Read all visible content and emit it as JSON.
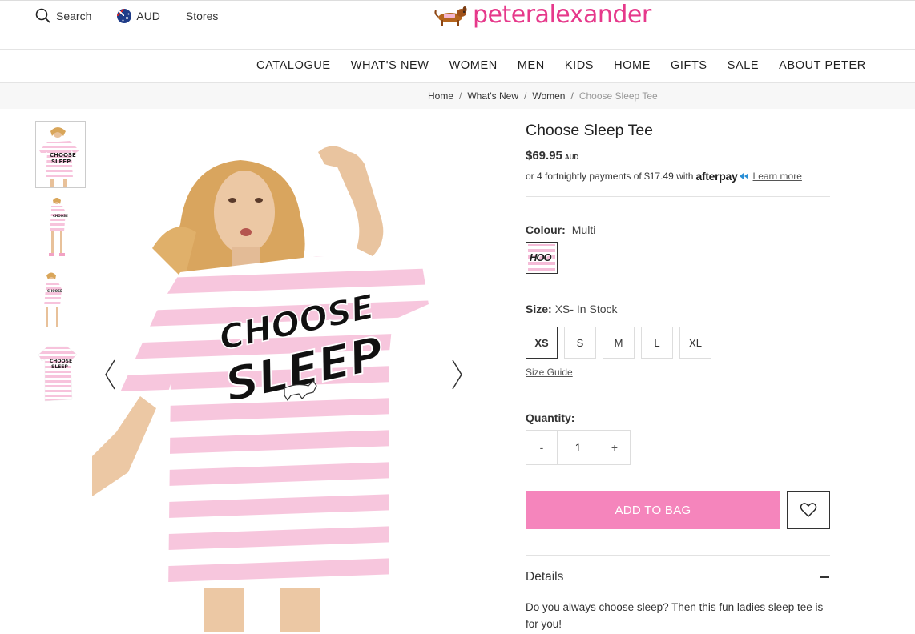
{
  "header": {
    "search_label": "Search",
    "currency_label": "AUD",
    "stores_label": "Stores",
    "logo_text": "peteralexander",
    "brand_color": "#e6398b"
  },
  "nav": {
    "items": [
      "CATALOGUE",
      "WHAT'S NEW",
      "WOMEN",
      "MEN",
      "KIDS",
      "HOME",
      "GIFTS",
      "SALE",
      "ABOUT PETER"
    ]
  },
  "breadcrumb": {
    "items": [
      "Home",
      "What's New",
      "Women"
    ],
    "current": "Choose Sleep Tee"
  },
  "product": {
    "title": "Choose Sleep Tee",
    "price": "$69.95",
    "currency": "AUD",
    "afterpay_text": "or 4 fortnightly payments of $17.49 with",
    "afterpay_brand": "afterpay",
    "afterpay_link": "Learn more",
    "colour_label": "Colour:",
    "colour_value": "Multi",
    "size_label": "Size:",
    "size_value": "XS- In Stock",
    "sizes": [
      "XS",
      "S",
      "M",
      "L",
      "XL"
    ],
    "selected_size": "XS",
    "size_guide": "Size Guide",
    "quantity_label": "Quantity:",
    "quantity_minus": "-",
    "quantity_value": "1",
    "quantity_plus": "+",
    "add_to_bag": "ADD TO BAG",
    "details_label": "Details",
    "details_text": "Do you always choose sleep? Then this fun ladies sleep tee is for you!",
    "accent_color": "#f585bc"
  },
  "icons": {
    "search": "search-icon",
    "flag": "australia-flag-icon",
    "wishlist": "heart-icon",
    "prev": "chevron-left-icon",
    "next": "chevron-right-icon",
    "collapse": "minus-icon"
  }
}
